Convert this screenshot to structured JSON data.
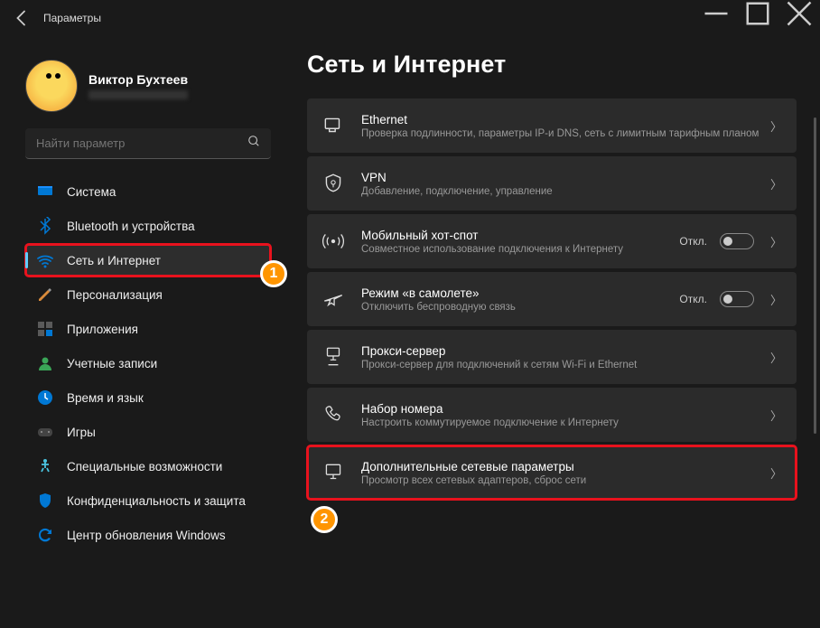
{
  "app_title": "Параметры",
  "profile": {
    "name": "Виктор Бухтеев"
  },
  "search": {
    "placeholder": "Найти параметр"
  },
  "nav": [
    {
      "id": "system",
      "label": "Система"
    },
    {
      "id": "bluetooth",
      "label": "Bluetooth и устройства"
    },
    {
      "id": "network",
      "label": "Сеть и Интернет",
      "selected": true
    },
    {
      "id": "personalization",
      "label": "Персонализация"
    },
    {
      "id": "apps",
      "label": "Приложения"
    },
    {
      "id": "accounts",
      "label": "Учетные записи"
    },
    {
      "id": "time",
      "label": "Время и язык"
    },
    {
      "id": "gaming",
      "label": "Игры"
    },
    {
      "id": "accessibility",
      "label": "Специальные возможности"
    },
    {
      "id": "privacy",
      "label": "Конфиденциальность и защита"
    },
    {
      "id": "update",
      "label": "Центр обновления Windows"
    }
  ],
  "page_title": "Сеть и Интернет",
  "cards": [
    {
      "id": "ethernet",
      "title": "Ethernet",
      "sub": "Проверка подлинности, параметры IP-и DNS, сеть с лимитным тарифным планом"
    },
    {
      "id": "vpn",
      "title": "VPN",
      "sub": "Добавление, подключение, управление"
    },
    {
      "id": "hotspot",
      "title": "Мобильный хот-спот",
      "sub": "Совместное использование подключения к Интернету",
      "status": "Откл.",
      "toggle": true
    },
    {
      "id": "airplane",
      "title": "Режим «в самолете»",
      "sub": "Отключить беспроводную связь",
      "status": "Откл.",
      "toggle": true
    },
    {
      "id": "proxy",
      "title": "Прокси-сервер",
      "sub": "Прокси-сервер для подключений к сетям Wi-Fi и Ethernet"
    },
    {
      "id": "dialup",
      "title": "Набор номера",
      "sub": "Настроить коммутируемое подключение к Интернету"
    },
    {
      "id": "advanced",
      "title": "Дополнительные сетевые параметры",
      "sub": "Просмотр всех сетевых адаптеров, сброс сети"
    }
  ],
  "badges": {
    "b1": "1",
    "b2": "2"
  }
}
